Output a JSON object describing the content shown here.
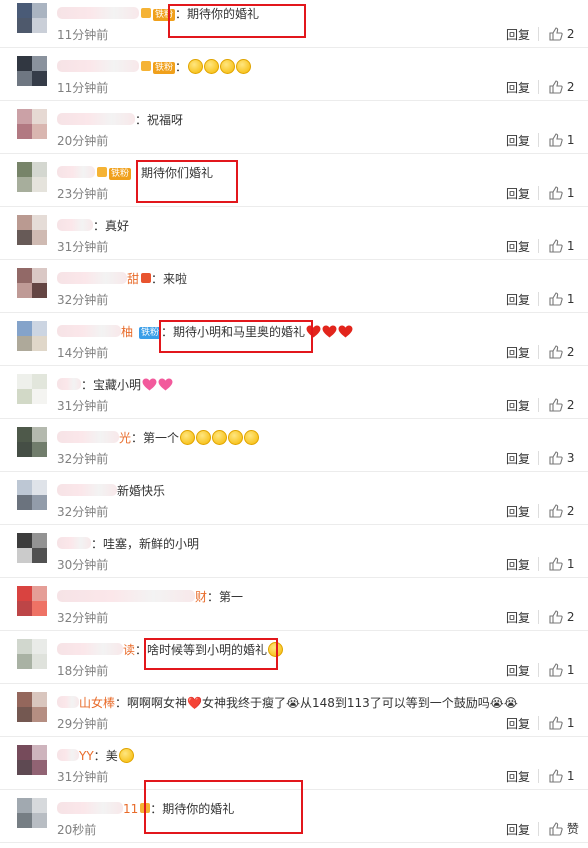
{
  "ui": {
    "reply_label": "回复",
    "separator": "|",
    "colon": "："
  },
  "comments": [
    {
      "suffix": "",
      "badge": "铁粉",
      "text": "期待你的婚礼",
      "time": "11分钟前",
      "likes": "2",
      "highlight": true
    },
    {
      "suffix": "",
      "badge": "铁粉",
      "text": "",
      "emojis": 4,
      "time": "11分钟前",
      "likes": "2",
      "highlight": false
    },
    {
      "suffix": "",
      "badge": "",
      "text": "祝福呀",
      "time": "20分钟前",
      "likes": "1",
      "highlight": false
    },
    {
      "suffix": "",
      "badge": "铁粉",
      "text": "期待你们婚礼",
      "time": "23分钟前",
      "likes": "1",
      "highlight": true
    },
    {
      "suffix": "",
      "badge": "",
      "text": "真好",
      "time": "31分钟前",
      "likes": "1",
      "highlight": false
    },
    {
      "suffix": "甜",
      "badge": "",
      "text": "来啦",
      "time": "32分钟前",
      "likes": "1",
      "highlight": false
    },
    {
      "suffix": "柚",
      "badge": "铁粉",
      "text": "期待小明和马里奥的婚礼",
      "hearts": 3,
      "time": "14分钟前",
      "likes": "2",
      "highlight": true
    },
    {
      "suffix": "",
      "badge": "",
      "text": "宝藏小明",
      "hearts": 2,
      "time": "31分钟前",
      "likes": "2",
      "highlight": false
    },
    {
      "suffix": "光",
      "badge": "",
      "text": "第一个",
      "emojis": 5,
      "time": "32分钟前",
      "likes": "3",
      "highlight": false
    },
    {
      "suffix": "新婚快乐",
      "badge": "",
      "text": "",
      "time": "32分钟前",
      "likes": "2",
      "highlight": false
    },
    {
      "suffix": "",
      "badge": "",
      "text": "哇塞，新鲜的小明",
      "time": "30分钟前",
      "likes": "1",
      "highlight": false
    },
    {
      "suffix": "财",
      "badge": "",
      "text": "第一",
      "time": "32分钟前",
      "likes": "2",
      "highlight": false
    },
    {
      "suffix": "读",
      "badge": "",
      "text": "啥时候等到小明的婚礼",
      "emojis": 1,
      "time": "18分钟前",
      "likes": "1",
      "highlight": true
    },
    {
      "suffix": "山女棒",
      "badge": "",
      "text": "啊啊啊女神❤️女神我终于瘦了😭从148到113了可以等到一个鼓励吗😭😭",
      "time": "29分钟前",
      "likes": "1",
      "highlight": false
    },
    {
      "suffix": "YY",
      "badge": "",
      "text": "美",
      "emojis": 1,
      "time": "31分钟前",
      "likes": "1",
      "highlight": false
    },
    {
      "suffix": "11",
      "badge": "",
      "text": "期待你的婚礼",
      "time": "20秒前",
      "likes": "赞",
      "highlight": true
    }
  ]
}
